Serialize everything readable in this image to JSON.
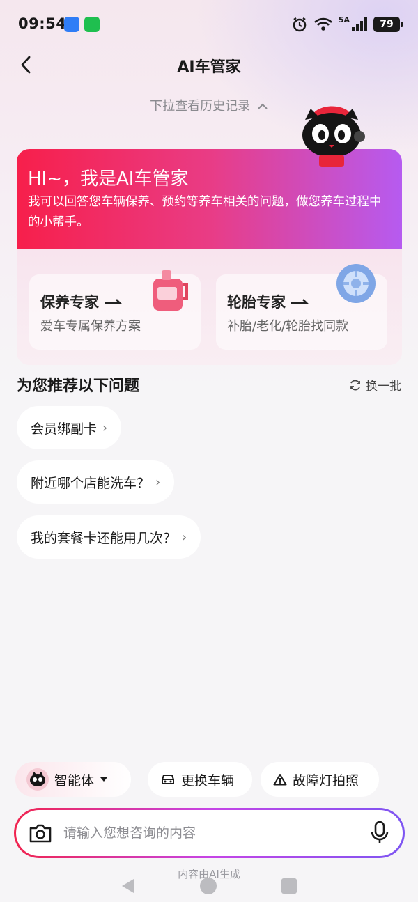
{
  "status_bar": {
    "time": "09:54",
    "network": "5A",
    "battery": "79"
  },
  "header": {
    "title": "AI车管家",
    "history_hint": "下拉查看历史记录"
  },
  "ai_card": {
    "greeting": "HI~，我是AI车管家",
    "intro": "我可以回答您车辆保养、预约等养车相关的问题，做您养车过程中的小帮手。",
    "experts": [
      {
        "title": "保养专家",
        "subtitle": "爱车专属保养方案",
        "icon": "oil-bottle-icon"
      },
      {
        "title": "轮胎专家",
        "subtitle": "补胎/老化/轮胎找同款",
        "icon": "tire-icon"
      }
    ]
  },
  "recommend": {
    "title": "为您推荐以下问题",
    "refresh": "换一批",
    "items": [
      "会员绑副卡",
      "附近哪个店能洗车？",
      "我的套餐卡还能用几次？"
    ]
  },
  "toolbar": {
    "agent": "智能体",
    "change_vehicle": "更换车辆",
    "fault_photo": "故障灯拍照"
  },
  "input": {
    "placeholder": "请输入您想咨询的内容"
  },
  "disclaimer": "内容由AI生成",
  "colors": {
    "accent_start": "#f71f4b",
    "accent_end": "#b65bf0"
  }
}
